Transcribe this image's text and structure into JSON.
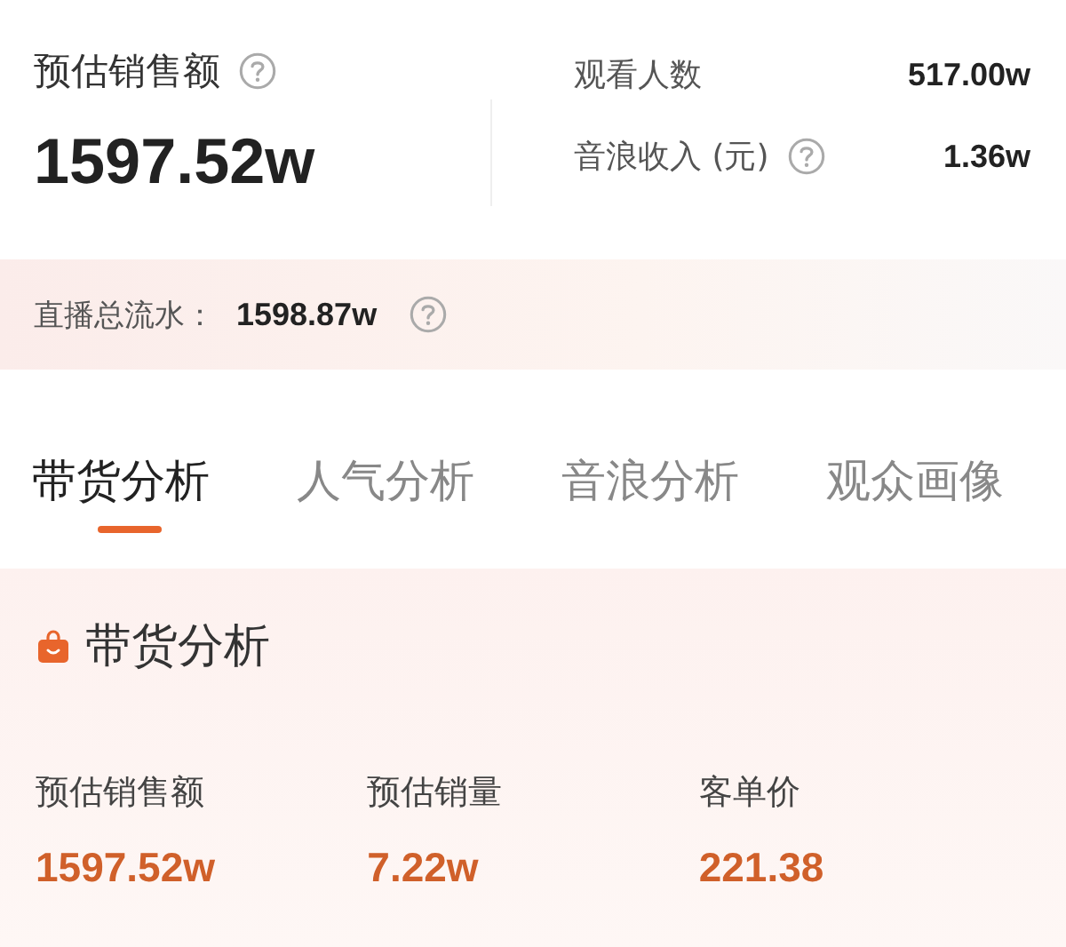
{
  "summary": {
    "title": "预估销售额",
    "help": true,
    "value": "1597.52w",
    "stats": [
      {
        "label": "观看人数",
        "help": false,
        "value": "517.00w"
      },
      {
        "label": "音浪收入 (元)",
        "help": true,
        "value": "1.36w"
      }
    ]
  },
  "total_flow": {
    "label": "直播总流水：",
    "value": "1598.87w",
    "help": true
  },
  "tabs": [
    {
      "label": "带货分析",
      "selected": true
    },
    {
      "label": "人气分析",
      "selected": false
    },
    {
      "label": "音浪分析",
      "selected": false
    },
    {
      "label": "观众画像",
      "selected": false
    }
  ],
  "section": {
    "title": "带货分析",
    "metrics": [
      {
        "label": "预估销售额",
        "value": "1597.52w"
      },
      {
        "label": "预估销量",
        "value": "7.22w"
      },
      {
        "label": "客单价",
        "value": "221.38"
      }
    ]
  }
}
